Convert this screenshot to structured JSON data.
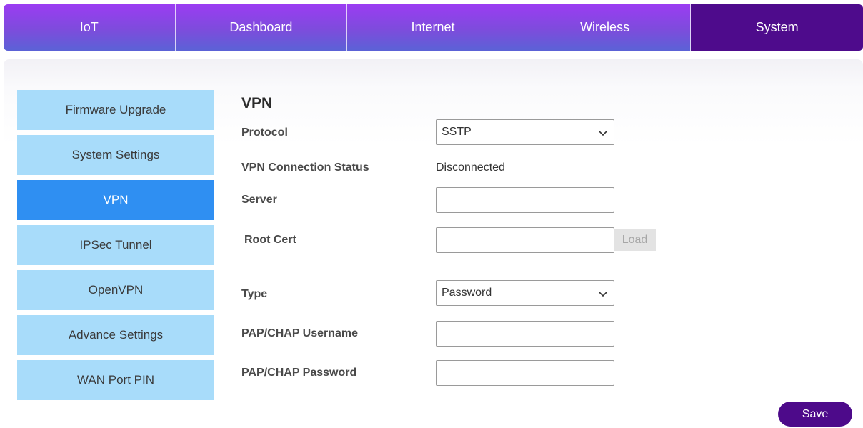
{
  "nav": {
    "tabs": [
      {
        "label": "IoT"
      },
      {
        "label": "Dashboard"
      },
      {
        "label": "Internet"
      },
      {
        "label": "Wireless"
      },
      {
        "label": "System"
      }
    ],
    "active": "System"
  },
  "sidebar": {
    "items": [
      {
        "label": "Firmware Upgrade"
      },
      {
        "label": "System Settings"
      },
      {
        "label": "VPN"
      },
      {
        "label": "IPSec Tunnel"
      },
      {
        "label": "OpenVPN"
      },
      {
        "label": "Advance Settings"
      },
      {
        "label": "WAN Port PIN"
      }
    ],
    "active": "VPN"
  },
  "form": {
    "title": "VPN",
    "protocol": {
      "label": "Protocol",
      "value": "SSTP"
    },
    "status": {
      "label": "VPN Connection Status",
      "value": "Disconnected"
    },
    "server": {
      "label": "Server",
      "value": ""
    },
    "root_cert": {
      "label": "Root Cert",
      "value": "",
      "button": "Load"
    },
    "type": {
      "label": "Type",
      "value": "Password"
    },
    "username": {
      "label": "PAP/CHAP Username",
      "value": ""
    },
    "password": {
      "label": "PAP/CHAP Password",
      "value": ""
    },
    "save_label": "Save"
  },
  "colors": {
    "nav_active": "#4e0b8c",
    "sidebar_item": "#a8dcfa",
    "sidebar_active": "#2f8ff2",
    "save_button": "#4d0a8a"
  }
}
